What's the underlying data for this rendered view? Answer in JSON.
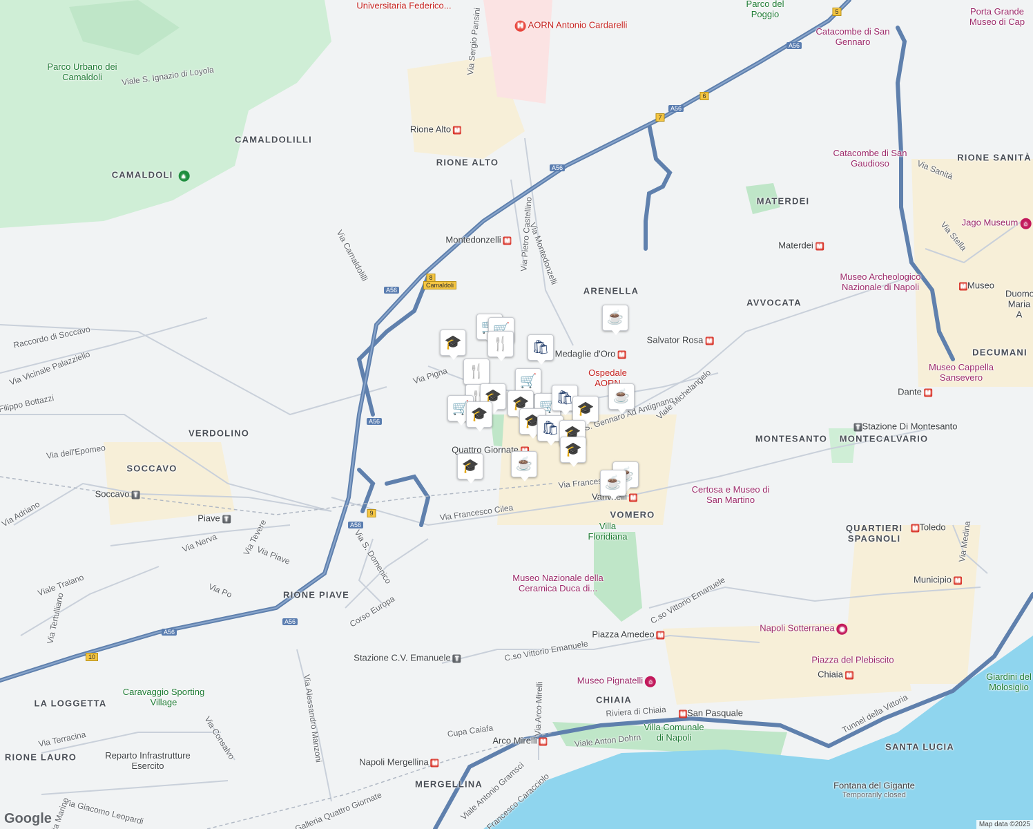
{
  "map": {
    "attribution": "Map data ©2025",
    "logo": "Google",
    "colors": {
      "land": "#f1f3f4",
      "park": "#c8ebd0",
      "water": "#8fd5ee",
      "highway": "#5f80ad",
      "road": "#c5ccd6",
      "urban": "#f7efd8"
    }
  },
  "areas": [
    {
      "name": "CAMALDOLILLI"
    },
    {
      "name": "CAMALDOLI"
    },
    {
      "name": "RIONE ALTO"
    },
    {
      "name": "ARENELLA"
    },
    {
      "name": "MATERDEI"
    },
    {
      "name": "RIONE SANITÀ"
    },
    {
      "name": "AVVOCATA"
    },
    {
      "name": "DECUMANI"
    },
    {
      "name": "VERDOLINO"
    },
    {
      "name": "SOCCAVO"
    },
    {
      "name": "MONTESANTO"
    },
    {
      "name": "MONTECALVARIO"
    },
    {
      "name": "VOMERO"
    },
    {
      "name": "QUARTIERI SPAGNOLI"
    },
    {
      "name": "RIONE PIAVE"
    },
    {
      "name": "CHIAIA"
    },
    {
      "name": "LA LOGGETTA"
    },
    {
      "name": "RIONE LAURO"
    },
    {
      "name": "MERGELLINA"
    },
    {
      "name": "SANTA LUCIA"
    }
  ],
  "stations": [
    "Rione Alto",
    "Montedonzelli",
    "Medaglie d'Oro",
    "Salvator Rosa",
    "Materdei",
    "Museo",
    "Dante",
    "Toledo",
    "Municipio",
    "Quattro Giornate",
    "Vanvitelli",
    "Chiaia",
    "San Pasquale",
    "Piazza Amedeo",
    "Arco Mirelli",
    "Napoli Mergellina",
    "Stazione Di Montesanto",
    "Stazione C.V. Emanuele",
    "Soccavo",
    "Piave",
    "Camaldoli"
  ],
  "pois": [
    "Universitaria Federico...",
    "AORN Antonio Cardarelli",
    "Parco del Poggio",
    "Catacombe di San Gennaro",
    "Porta Grande Museo di Cap",
    "Catacombe di San Gaudioso",
    "Jago Museum",
    "Museo Archeologico Nazionale di Napoli",
    "Duomo Maria A",
    "Museo Cappella Sansevero",
    "Certosa e Museo di San Martino",
    "Villa Floridiana",
    "Museo Nazionale della Ceramica Duca di...",
    "Napoli Sotterranea",
    "Piazza del Plebiscito",
    "Giardini del Molosiglio",
    "Museo Pignatelli",
    "Villa Comunale di Napoli",
    "Fontana del Gigante",
    "Temporarily closed",
    "Parco Urbano dei Camaldoli",
    "Caravaggio Sporting Village",
    "Reparto Infrastrutture Esercito",
    "Ospedale AORN"
  ],
  "streets": [
    "Via Sergio Pansini",
    "Viale S. Ignazio di Loyola",
    "Via Pietro Castellino",
    "Via Montedonzelli",
    "Via Camaldolilli",
    "Raccordo di Soccavo",
    "Via Vicinale Palazziello",
    "Filippo Bottazzi",
    "Via Pigna",
    "Via dell'Epomeo",
    "Via S. Gennaro Ad Antignano",
    "Viale Michelangelo",
    "Via Francesco Cilea",
    "Via Adriano",
    "Viale Traiano",
    "Via Nerva",
    "Via Tevere",
    "Via Piave",
    "Via Po",
    "Via S. Domenico",
    "Corso Europa",
    "Via Tertulliano",
    "C.so Vittorio Emanuele",
    "Via Alessandro Manzoni",
    "Via Consalvo",
    "Via Terracina",
    "Cupa Caiafa",
    "Via Arco Mirelli",
    "Riviera di Chiaia",
    "Viale Anton Dohrn",
    "Via Giacomo Leopardi",
    "Galleria Quattro Giornate",
    "Viale Antonio Gramsci",
    "V. Francesco Caracciolo",
    "Tunnel della Vittoria",
    "Via Medina",
    "Via Stella",
    "Via Sanità",
    "Via Marino",
    "Via Francesco Cilea"
  ],
  "markers": [
    {
      "icon": "cafe",
      "label": "cafe-marker"
    },
    {
      "icon": "shopping-cart",
      "label": "grocery-marker"
    },
    {
      "icon": "shopping-cart",
      "label": "grocery-marker"
    },
    {
      "icon": "restaurant",
      "label": "restaurant-marker"
    },
    {
      "icon": "shopping-bag",
      "label": "store-marker"
    },
    {
      "icon": "school",
      "label": "school-marker"
    },
    {
      "icon": "restaurant",
      "label": "restaurant-marker"
    },
    {
      "icon": "restaurant",
      "label": "restaurant-marker"
    },
    {
      "icon": "school",
      "label": "school-marker"
    },
    {
      "icon": "shopping-cart",
      "label": "grocery-marker"
    },
    {
      "icon": "school",
      "label": "school-marker"
    },
    {
      "icon": "shopping-cart",
      "label": "grocery-marker"
    },
    {
      "icon": "school",
      "label": "school-marker"
    },
    {
      "icon": "shopping-cart",
      "label": "grocery-marker"
    },
    {
      "icon": "shopping-bag",
      "label": "store-marker"
    },
    {
      "icon": "school",
      "label": "school-marker"
    },
    {
      "icon": "shopping-bag",
      "label": "store-marker"
    },
    {
      "icon": "school",
      "label": "school-marker"
    },
    {
      "icon": "school",
      "label": "school-marker"
    },
    {
      "icon": "cafe",
      "label": "cafe-marker"
    },
    {
      "icon": "cafe",
      "label": "cafe-marker"
    },
    {
      "icon": "cafe",
      "label": "cafe-marker"
    },
    {
      "icon": "school",
      "label": "school-marker"
    },
    {
      "icon": "cafe",
      "label": "cafe-marker"
    }
  ],
  "shields": [
    "A56",
    "A56",
    "A56",
    "A56",
    "A56",
    "A56",
    "A56",
    "A56",
    "5",
    "6",
    "7",
    "8",
    "9",
    "10"
  ]
}
